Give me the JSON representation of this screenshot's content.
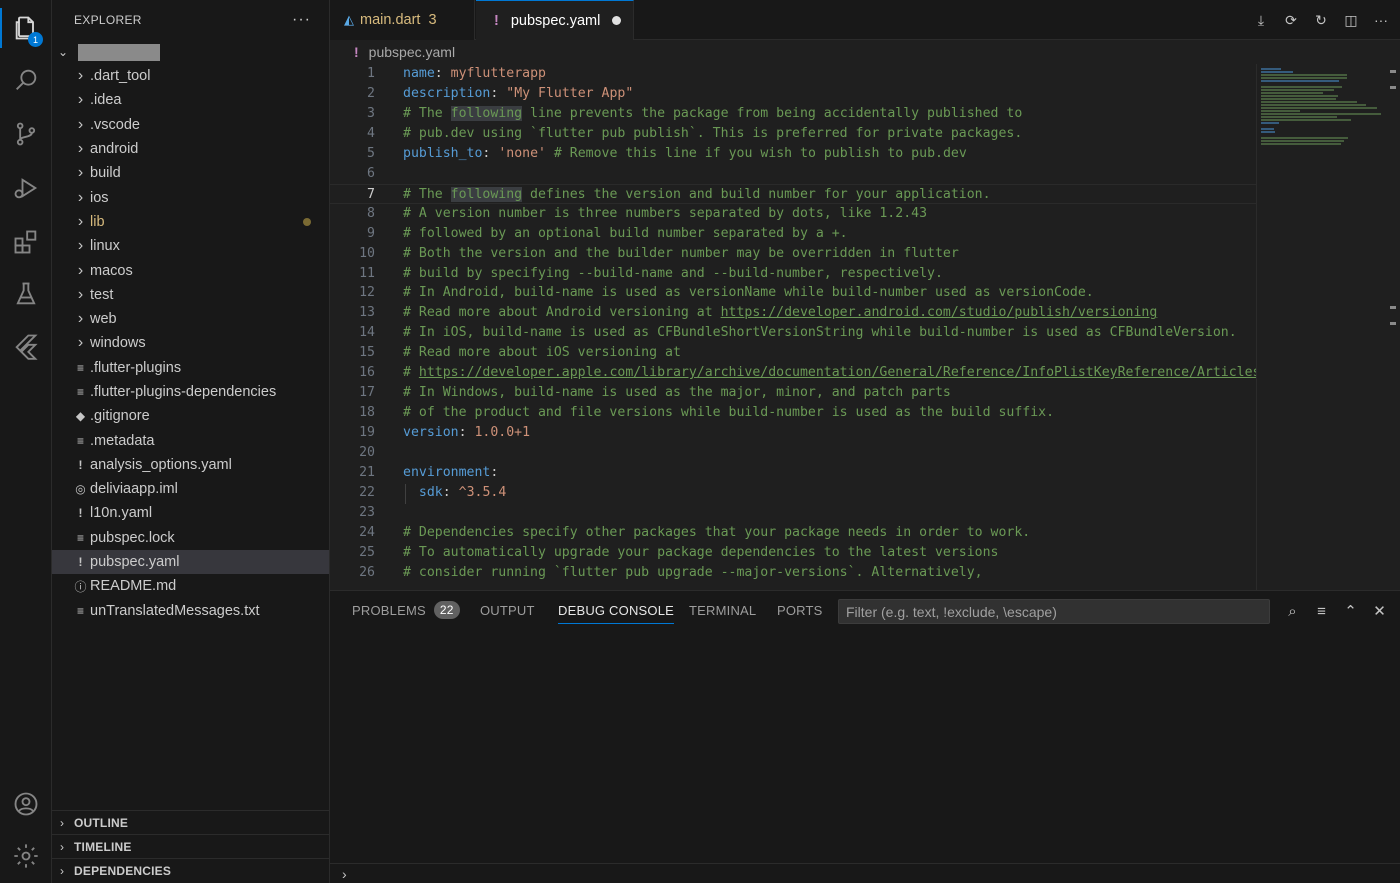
{
  "activity_bar": {
    "explorer_badge": "1",
    "icons": [
      "files-icon",
      "search-icon",
      "source-control-icon",
      "run-debug-icon",
      "extensions-icon",
      "testing-icon",
      "flutter-icon",
      "account-icon",
      "settings-icon"
    ]
  },
  "sidebar": {
    "title": "EXPLORER",
    "more": "···",
    "items": [
      {
        "label": ".dart_tool",
        "type": "folder"
      },
      {
        "label": ".idea",
        "type": "folder"
      },
      {
        "label": ".vscode",
        "type": "folder"
      },
      {
        "label": "android",
        "type": "folder"
      },
      {
        "label": "build",
        "type": "folder"
      },
      {
        "label": "ios",
        "type": "folder"
      },
      {
        "label": "lib",
        "type": "folder"
      },
      {
        "label": "linux",
        "type": "folder"
      },
      {
        "label": "macos",
        "type": "folder"
      },
      {
        "label": "test",
        "type": "folder"
      },
      {
        "label": "web",
        "type": "folder"
      },
      {
        "label": "windows",
        "type": "folder"
      },
      {
        "label": ".flutter-plugins",
        "type": "file"
      },
      {
        "label": ".flutter-plugins-dependencies",
        "type": "file"
      },
      {
        "label": ".gitignore",
        "type": "git"
      },
      {
        "label": ".metadata",
        "type": "file"
      },
      {
        "label": "analysis_options.yaml",
        "type": "yaml"
      },
      {
        "label": "deliviaapp.iml",
        "type": "iml"
      },
      {
        "label": "l10n.yaml",
        "type": "yaml"
      },
      {
        "label": "pubspec.lock",
        "type": "file"
      },
      {
        "label": "pubspec.yaml",
        "type": "yaml"
      },
      {
        "label": "README.md",
        "type": "info"
      },
      {
        "label": "unTranslatedMessages.txt",
        "type": "file"
      }
    ],
    "sections": [
      "OUTLINE",
      "TIMELINE",
      "DEPENDENCIES"
    ]
  },
  "tabs": [
    {
      "label": "main.dart",
      "count": "3"
    },
    {
      "label": "pubspec.yaml"
    }
  ],
  "breadcrumb": "pubspec.yaml",
  "editor": {
    "current_line": 7,
    "lines": [
      "name: myflutterapp",
      "description: \"My Flutter App\"",
      "# The following line prevents the package from being accidentally published to",
      "# pub.dev using `flutter pub publish`. This is preferred for private packages.",
      "publish_to: 'none' # Remove this line if you wish to publish to pub.dev",
      "",
      "# The following defines the version and build number for your application.",
      "# A version number is three numbers separated by dots, like 1.2.43",
      "# followed by an optional build number separated by a +.",
      "# Both the version and the builder number may be overridden in flutter",
      "# build by specifying --build-name and --build-number, respectively.",
      "# In Android, build-name is used as versionName while build-number used as versionCode.",
      "# Read more about Android versioning at https://developer.android.com/studio/publish/versioning",
      "# In iOS, build-name is used as CFBundleShortVersionString while build-number is used as CFBundleVersion.",
      "# Read more about iOS versioning at",
      "# https://developer.apple.com/library/archive/documentation/General/Reference/InfoPlistKeyReference/Articles/CoreFoundationKeys.html",
      "# In Windows, build-name is used as the major, minor, and patch parts",
      "# of the product and file versions while build-number is used as the build suffix.",
      "version: 1.0.0+1",
      "",
      "environment:",
      "  sdk: ^3.5.4",
      "",
      "# Dependencies specify other packages that your package needs in order to work.",
      "# To automatically upgrade your package dependencies to the latest versions",
      "# consider running `flutter pub upgrade --major-versions`. Alternatively,"
    ]
  },
  "panel": {
    "tabs": [
      "PROBLEMS",
      "OUTPUT",
      "DEBUG CONSOLE",
      "TERMINAL",
      "PORTS"
    ],
    "problems_count": "22",
    "active_tab": "DEBUG CONSOLE",
    "filter_placeholder": "Filter (e.g. text, !exclude, \\escape)"
  },
  "colors": {
    "accent": "#0078d4",
    "keyword": "#569cd6",
    "string": "#ce9178",
    "comment": "#6a9955",
    "number": "#b5cea8"
  }
}
